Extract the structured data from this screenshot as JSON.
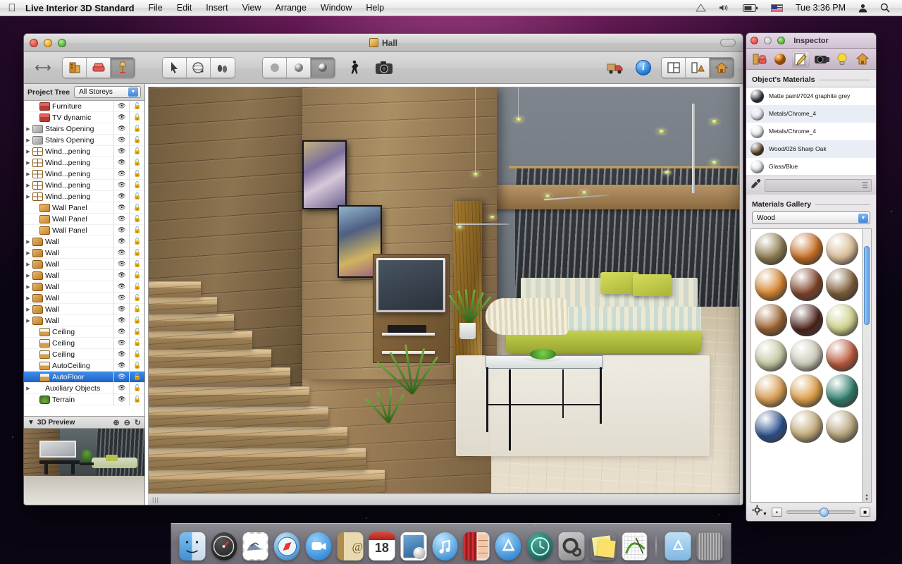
{
  "menubar": {
    "apple_icon": "apple-icon",
    "app_title": "Live Interior 3D Standard",
    "items": [
      "File",
      "Edit",
      "Insert",
      "View",
      "Arrange",
      "Window",
      "Help"
    ],
    "status_icons": [
      "airport-icon",
      "volume-icon",
      "battery-icon",
      "flag-icon"
    ],
    "clock": "Tue 3:36 PM",
    "user_icon": "user-icon",
    "search_icon": "spotlight-search-icon"
  },
  "window": {
    "title": "Hall",
    "doc_icon": "document-icon",
    "toolbar": {
      "resize_icon": "resize-arrows-icon",
      "group_objects": [
        {
          "name": "building-tool",
          "icon": "building-icon"
        },
        {
          "name": "furniture-tool",
          "icon": "armchair-icon"
        },
        {
          "name": "materials-tool",
          "icon": "lamp-icon",
          "active": true
        }
      ],
      "group_select": [
        {
          "name": "arrow-tool",
          "icon": "arrow-cursor-icon",
          "active": false
        },
        {
          "name": "orbit-tool",
          "icon": "orbit-icon",
          "active": false
        },
        {
          "name": "walk-tool",
          "icon": "footsteps-icon",
          "active": false
        }
      ],
      "group_render": [
        {
          "name": "render-flat",
          "icon": "flat-sphere-icon",
          "active": false
        },
        {
          "name": "render-shaded",
          "icon": "shaded-sphere-icon",
          "active": false
        },
        {
          "name": "render-realistic",
          "icon": "realistic-sphere-icon",
          "active": true
        }
      ],
      "walk_icon": "walking-person-icon",
      "camera_icon": "camera-icon",
      "car_icon": "moving-truck-icon",
      "info_icon": "info-icon",
      "view_modes": [
        {
          "name": "view-2d-plan",
          "icon": "plan-view-icon",
          "active": false
        },
        {
          "name": "view-split",
          "icon": "split-view-icon",
          "active": false
        },
        {
          "name": "view-3d",
          "icon": "house-3d-icon",
          "active": true
        }
      ]
    },
    "statusbar_grip": "|||"
  },
  "sidebar": {
    "project_tree_label": "Project Tree",
    "storey_selector": {
      "value": "All Storeys",
      "arrow_icon": "chevron-down-icon"
    },
    "tree_items": [
      {
        "label": "Furniture",
        "icon": "furniture-icon",
        "indent": 1,
        "expandable": false,
        "selected": false
      },
      {
        "label": "TV dynamic",
        "icon": "furniture-icon",
        "indent": 1,
        "expandable": false,
        "selected": false
      },
      {
        "label": "Stairs Opening",
        "icon": "stairs-icon",
        "indent": 0,
        "expandable": true,
        "selected": false
      },
      {
        "label": "Stairs Opening",
        "icon": "stairs-icon",
        "indent": 0,
        "expandable": true,
        "selected": false
      },
      {
        "label": "Wind...pening",
        "icon": "window-icon",
        "indent": 0,
        "expandable": true,
        "selected": false
      },
      {
        "label": "Wind...pening",
        "icon": "window-icon",
        "indent": 0,
        "expandable": true,
        "selected": false
      },
      {
        "label": "Wind...pening",
        "icon": "window-icon",
        "indent": 0,
        "expandable": true,
        "selected": false
      },
      {
        "label": "Wind...pening",
        "icon": "window-icon",
        "indent": 0,
        "expandable": true,
        "selected": false
      },
      {
        "label": "Wind...pening",
        "icon": "window-icon",
        "indent": 0,
        "expandable": true,
        "selected": false
      },
      {
        "label": "Wall Panel",
        "icon": "panel-icon",
        "indent": 1,
        "expandable": false,
        "selected": false
      },
      {
        "label": "Wall Panel",
        "icon": "panel-icon",
        "indent": 1,
        "expandable": false,
        "selected": false
      },
      {
        "label": "Wall Panel",
        "icon": "panel-icon",
        "indent": 1,
        "expandable": false,
        "selected": false
      },
      {
        "label": "Wall",
        "icon": "wall-icon",
        "indent": 0,
        "expandable": true,
        "selected": false
      },
      {
        "label": "Wall",
        "icon": "wall-icon",
        "indent": 0,
        "expandable": true,
        "selected": false
      },
      {
        "label": "Wall",
        "icon": "wall-icon",
        "indent": 0,
        "expandable": true,
        "selected": false
      },
      {
        "label": "Wall",
        "icon": "wall-icon",
        "indent": 0,
        "expandable": true,
        "selected": false
      },
      {
        "label": "Wall",
        "icon": "wall-icon",
        "indent": 0,
        "expandable": true,
        "selected": false
      },
      {
        "label": "Wall",
        "icon": "wall-icon",
        "indent": 0,
        "expandable": true,
        "selected": false
      },
      {
        "label": "Wall",
        "icon": "wall-icon",
        "indent": 0,
        "expandable": true,
        "selected": false
      },
      {
        "label": "Wall",
        "icon": "wall-icon",
        "indent": 0,
        "expandable": true,
        "selected": false
      },
      {
        "label": "Ceiling",
        "icon": "ceiling-icon",
        "indent": 1,
        "expandable": false,
        "selected": false
      },
      {
        "label": "Ceiling",
        "icon": "ceiling-icon",
        "indent": 1,
        "expandable": false,
        "selected": false
      },
      {
        "label": "Ceiling",
        "icon": "ceiling-icon",
        "indent": 1,
        "expandable": false,
        "selected": false
      },
      {
        "label": "AutoCeiling",
        "icon": "ceiling-icon",
        "indent": 1,
        "expandable": false,
        "selected": false
      },
      {
        "label": "AutoFloor",
        "icon": "ceiling-icon",
        "indent": 1,
        "expandable": false,
        "selected": true
      },
      {
        "label": "Auxiliary Objects",
        "icon": "group-icon",
        "indent": 0,
        "expandable": true,
        "selected": false
      },
      {
        "label": "Terrain",
        "icon": "terrain-icon",
        "indent": 1,
        "expandable": false,
        "selected": false
      }
    ],
    "column_icons": {
      "visibility": "eye-icon",
      "lock": "padlock-icon"
    },
    "preview": {
      "label": "3D Preview",
      "disclosure_icon": "disclosure-triangle-icon",
      "zoom_in_icon": "zoom-in-icon",
      "zoom_out_icon": "zoom-out-icon",
      "rotate_icon": "rotate-icon"
    }
  },
  "inspector": {
    "title": "Inspector",
    "tabs": [
      {
        "name": "tab-object",
        "icon": "furniture-tab-icon",
        "active": false
      },
      {
        "name": "tab-material",
        "icon": "sphere-tab-icon",
        "active": false
      },
      {
        "name": "tab-edit",
        "icon": "pencil-tab-icon",
        "active": true
      },
      {
        "name": "tab-camera",
        "icon": "camera-tab-icon",
        "active": false
      },
      {
        "name": "tab-light",
        "icon": "lightbulb-tab-icon",
        "active": false
      },
      {
        "name": "tab-site",
        "icon": "house-tab-icon",
        "active": false
      }
    ],
    "objects_materials": {
      "heading": "Object's Materials",
      "items": [
        {
          "name": "Matte paint/7024 graphite grey",
          "color": "#2b3038"
        },
        {
          "name": "Metals/Chrome_4",
          "color": "#f0f2f4"
        },
        {
          "name": "Metals/Chrome_4",
          "color": "#eceef1"
        },
        {
          "name": "Wood/026 Sharp Oak",
          "color": "#5a3a18"
        },
        {
          "name": "Glass/Blue",
          "color": "#dde8ec"
        }
      ],
      "eyedropper_icon": "eyedropper-icon",
      "menu_icon": "list-menu-icon"
    },
    "materials_gallery": {
      "heading": "Materials Gallery",
      "category": "Wood",
      "category_arrow_icon": "chevron-down-icon",
      "swatches": [
        "#8d7a4e",
        "#c46a1e",
        "#d9bb94",
        "#d4822b",
        "#7b3f24",
        "#7c5a34",
        "#9a5f2c",
        "#4b2018",
        "#cfd08a",
        "#c6c7a2",
        "#ccc9b8",
        "#b95638",
        "#d79a4e",
        "#d99a42",
        "#2b7a68",
        "#2a4f8c",
        "#c0a877",
        "#b6a27a"
      ],
      "settings_icon": "gear-icon",
      "small_icon_view": "small-icon-view",
      "large_icon_view": "large-icon-view",
      "size_slider_value": 50
    }
  },
  "dock": {
    "items": [
      {
        "name": "dock-finder",
        "label": "Finder",
        "icon": "finder-icon",
        "running": true
      },
      {
        "name": "dock-dashboard",
        "label": "Dashboard",
        "icon": "dashboard-icon",
        "running": false
      },
      {
        "name": "dock-mail",
        "label": "Mail",
        "icon": "mail-stamp-icon",
        "running": false
      },
      {
        "name": "dock-safari",
        "label": "Safari",
        "icon": "safari-compass-icon",
        "running": false
      },
      {
        "name": "dock-facetime",
        "label": "FaceTime",
        "icon": "facetime-video-icon",
        "running": false
      },
      {
        "name": "dock-addressbook",
        "label": "Address Book",
        "icon": "address-book-icon",
        "running": false
      },
      {
        "name": "dock-ical",
        "label": "iCal",
        "icon": "calendar-18-icon",
        "running": false
      },
      {
        "name": "dock-iphoto",
        "label": "iPhoto",
        "icon": "iphoto-icon",
        "running": false
      },
      {
        "name": "dock-itunes",
        "label": "iTunes",
        "icon": "itunes-note-icon",
        "running": false
      },
      {
        "name": "dock-photobooth",
        "label": "Photo Booth",
        "icon": "photobooth-icon",
        "running": false
      },
      {
        "name": "dock-appstore",
        "label": "App Store",
        "icon": "appstore-icon",
        "running": false
      },
      {
        "name": "dock-timemachine",
        "label": "Time Machine",
        "icon": "timemachine-icon",
        "running": false
      },
      {
        "name": "dock-systemprefs",
        "label": "System Preferences",
        "icon": "gears-icon",
        "running": false
      },
      {
        "name": "dock-stickies",
        "label": "Stickies",
        "icon": "sticky-notes-icon",
        "running": false
      },
      {
        "name": "dock-liveinterior",
        "label": "Live Interior 3D",
        "icon": "live-interior-icon",
        "running": true
      }
    ],
    "folder": {
      "name": "dock-applications-folder",
      "label": "Applications",
      "icon": "folder-icon"
    },
    "trash": {
      "name": "dock-trash",
      "label": "Trash",
      "icon": "trash-icon"
    },
    "calendar_day": "18"
  }
}
